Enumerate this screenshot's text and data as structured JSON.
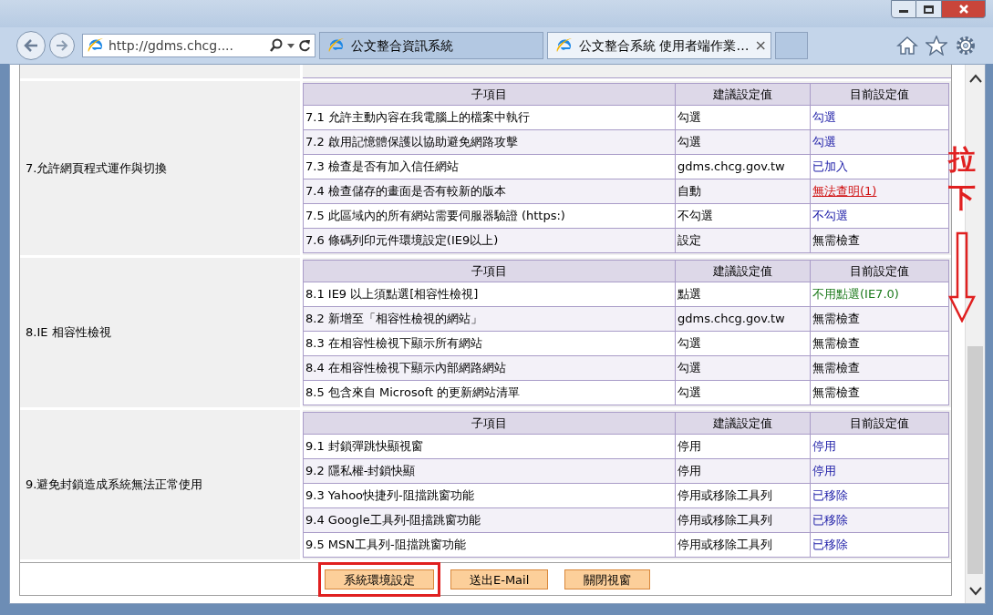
{
  "browser": {
    "address": "http://gdms.chcg....",
    "tabs": [
      {
        "title": "公文整合資訊系統",
        "selected": false
      },
      {
        "title": "公文整合系統 使用者端作業…",
        "selected": true,
        "close": "×"
      }
    ]
  },
  "sections": [
    {
      "title": "7.允許網頁程式運作與切換",
      "header": [
        "子項目",
        "建議設定值",
        "目前設定值"
      ],
      "rows": [
        {
          "item": "7.1 允許主動內容在我電腦上的檔案中執行",
          "suggested": "勾選",
          "current": "勾選",
          "kind": "link"
        },
        {
          "item": "7.2 啟用記憶體保護以協助避免網路攻擊",
          "suggested": "勾選",
          "current": "勾選",
          "kind": "link"
        },
        {
          "item": "7.3 檢查是否有加入信任網站",
          "suggested": "gdms.chcg.gov.tw",
          "current": "已加入",
          "kind": "link"
        },
        {
          "item": "7.4 檢查儲存的畫面是否有較新的版本",
          "suggested": "自動",
          "current": "無法查明(1)",
          "kind": "error"
        },
        {
          "item": "7.5 此區域內的所有網站需要伺服器驗證 (https:)",
          "suggested": "不勾選",
          "current": "不勾選",
          "kind": "link"
        },
        {
          "item": "7.6 條碼列印元件環境設定(IE9以上)",
          "suggested": "設定",
          "current": "無需檢查",
          "kind": "plain"
        }
      ]
    },
    {
      "title": "8.IE 相容性檢視",
      "header": [
        "子項目",
        "建議設定值",
        "目前設定值"
      ],
      "rows": [
        {
          "item": "8.1 IE9 以上須點選[相容性檢視]",
          "suggested": "點選",
          "current": "不用點選(IE7.0)",
          "kind": "ok"
        },
        {
          "item": "8.2 新增至「相容性檢視的網站」",
          "suggested": "gdms.chcg.gov.tw",
          "current": "無需檢查",
          "kind": "plain"
        },
        {
          "item": "8.3 在相容性檢視下顯示所有網站",
          "suggested": "勾選",
          "current": "無需檢查",
          "kind": "plain"
        },
        {
          "item": "8.4 在相容性檢視下顯示內部網路網站",
          "suggested": "勾選",
          "current": "無需檢查",
          "kind": "plain"
        },
        {
          "item": "8.5 包含來自 Microsoft 的更新網站清單",
          "suggested": "勾選",
          "current": "無需檢查",
          "kind": "plain"
        }
      ]
    },
    {
      "title": "9.避免封鎖造成系統無法正常使用",
      "header": [
        "子項目",
        "建議設定值",
        "目前設定值"
      ],
      "rows": [
        {
          "item": "9.1 封鎖彈跳快顯視窗",
          "suggested": "停用",
          "current": "停用",
          "kind": "link"
        },
        {
          "item": "9.2 隱私權-封鎖快顯",
          "suggested": "停用",
          "current": "停用",
          "kind": "link"
        },
        {
          "item": "9.3 Yahoo快捷列-阻擋跳窗功能",
          "suggested": "停用或移除工具列",
          "current": "已移除",
          "kind": "link"
        },
        {
          "item": "9.4 Google工具列-阻擋跳窗功能",
          "suggested": "停用或移除工具列",
          "current": "已移除",
          "kind": "link"
        },
        {
          "item": "9.5 MSN工具列-阻擋跳窗功能",
          "suggested": "停用或移除工具列",
          "current": "已移除",
          "kind": "link"
        }
      ]
    }
  ],
  "buttons": [
    {
      "label": "系統環境設定",
      "highlighted": true
    },
    {
      "label": "送出E-Mail",
      "highlighted": false
    },
    {
      "label": "關閉視窗",
      "highlighted": false
    }
  ],
  "annotation": {
    "characters": [
      "拉",
      "下"
    ]
  }
}
